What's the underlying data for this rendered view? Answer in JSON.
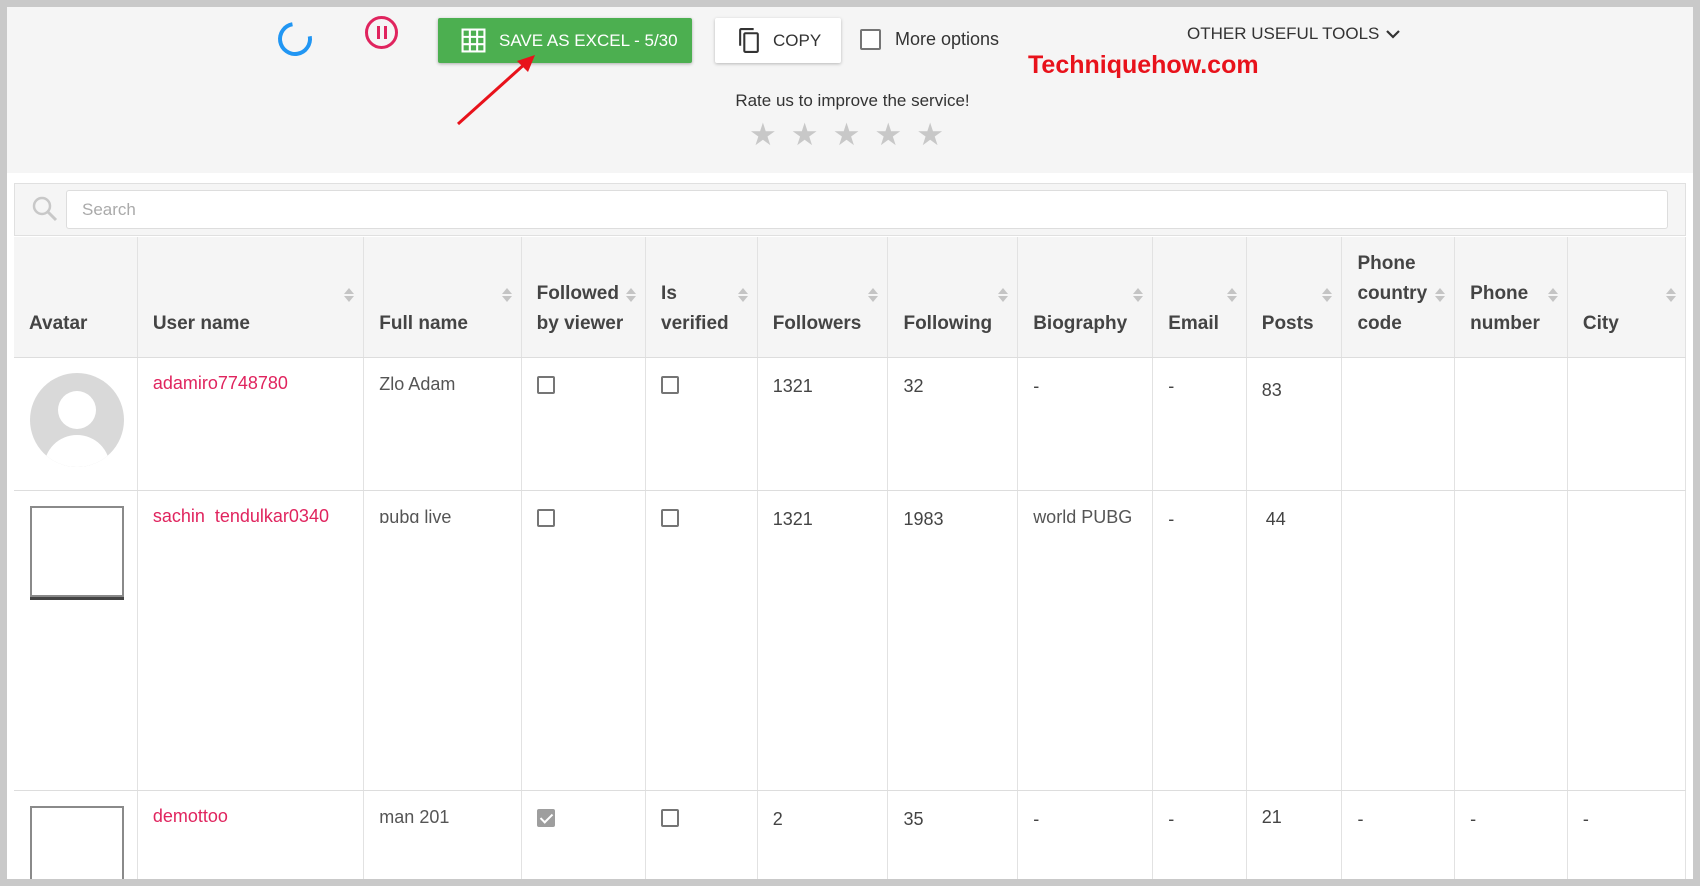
{
  "toolbar": {
    "excel_label": "SAVE AS EXCEL - 5/30",
    "copy_label": "COPY",
    "more_options_label": "More options",
    "other_tools_label": "OTHER USEFUL TOOLS",
    "rate_text": "Rate us to improve the service!",
    "stars": 5,
    "accent_green": "#4caf50",
    "accent_blue": "#2196f3",
    "accent_pink": "#e0245e"
  },
  "watermark": "Techniquehow.com",
  "search": {
    "placeholder": "Search",
    "value": ""
  },
  "table": {
    "columns": [
      {
        "label": "Avatar",
        "sortable": false
      },
      {
        "label": "User name",
        "sortable": true
      },
      {
        "label": "Full name",
        "sortable": true
      },
      {
        "label": "Followed by viewer",
        "sortable": true
      },
      {
        "label": "Is verified",
        "sortable": true
      },
      {
        "label": "Followers",
        "sortable": true
      },
      {
        "label": "Following",
        "sortable": true
      },
      {
        "label": "Biography",
        "sortable": true
      },
      {
        "label": "Email",
        "sortable": true
      },
      {
        "label": "Posts",
        "sortable": true
      },
      {
        "label": "Phone country code",
        "sortable": true
      },
      {
        "label": "Phone number",
        "sortable": true
      },
      {
        "label": "City",
        "sortable": true
      }
    ],
    "rows": [
      {
        "avatar": "default-avatar",
        "username": "adamiro7748780",
        "fullname": "Zlo Adam",
        "followed_by_viewer": false,
        "is_verified": false,
        "followers": "1321",
        "following": "32",
        "biography": "-",
        "email": "-",
        "posts": "83",
        "phone_country_code": "",
        "phone_number": "",
        "city": ""
      },
      {
        "avatar": "photo",
        "username": "sachin_tendulkar0340",
        "fullname": "pubg live mobile",
        "followed_by_viewer": false,
        "is_verified": false,
        "followers": "1321",
        "following": "1983",
        "biography": "world PUBG",
        "email": "-",
        "posts": "44",
        "phone_country_code": "",
        "phone_number": "",
        "city": ""
      },
      {
        "avatar": "photo",
        "username": "demottoo",
        "fullname": "man 201",
        "followed_by_viewer": true,
        "is_verified": false,
        "followers": "2",
        "following": "35",
        "biography": "-",
        "email": "-",
        "posts": "21",
        "phone_country_code": "-",
        "phone_number": "-",
        "city": "-"
      }
    ]
  }
}
